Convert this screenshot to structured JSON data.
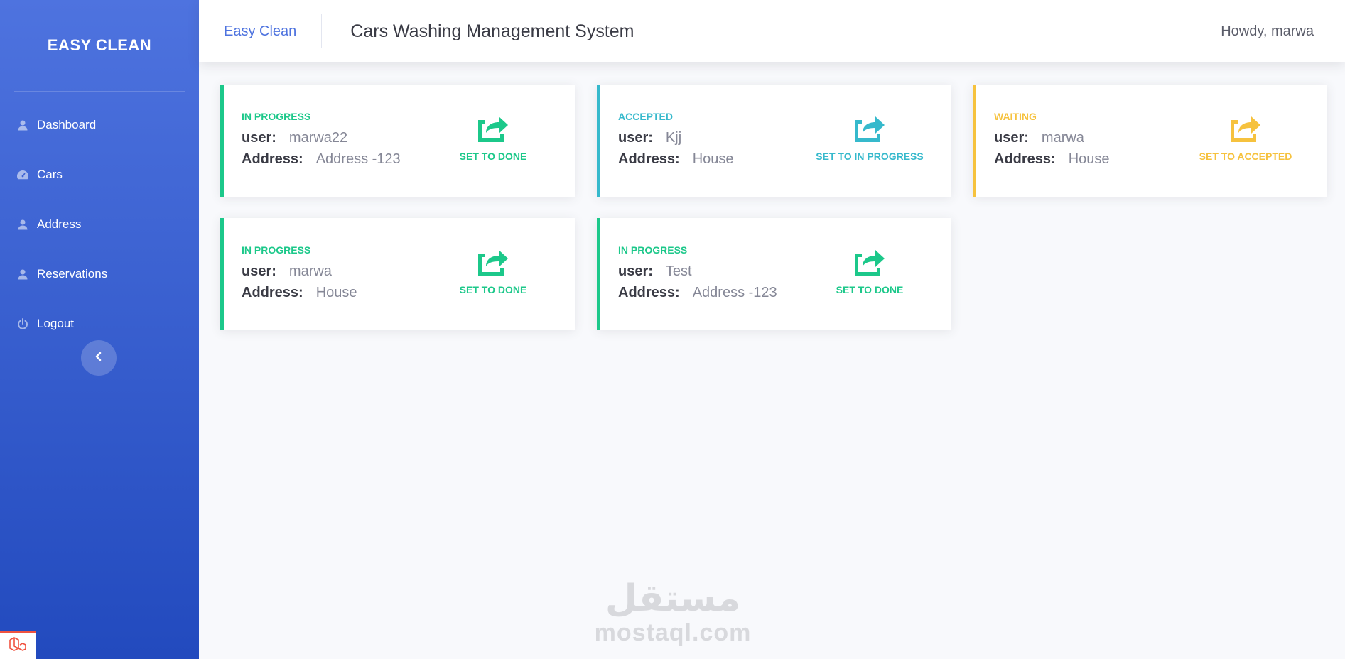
{
  "sidebar": {
    "brand": "EASY CLEAN",
    "items": [
      {
        "label": "Dashboard",
        "icon": "user-icon"
      },
      {
        "label": "Cars",
        "icon": "dashboard-gauge-icon"
      },
      {
        "label": "Address",
        "icon": "user-icon"
      },
      {
        "label": "Reservations",
        "icon": "user-icon"
      },
      {
        "label": "Logout",
        "icon": "power-icon"
      }
    ]
  },
  "topbar": {
    "brand_link": "Easy Clean",
    "title": "Cars Washing Management System",
    "greeting": "Howdy, marwa"
  },
  "cards": [
    {
      "status": "IN PROGRESS",
      "user_key": "user:",
      "user": "marwa22",
      "address_key": "Address:",
      "address": "Address -123",
      "action": "SET TO DONE",
      "color": "#1cc88a"
    },
    {
      "status": "ACCEPTED",
      "user_key": "user:",
      "user": "Kjj",
      "address_key": "Address:",
      "address": "House",
      "action": "SET TO IN PROGRESS",
      "color": "#36b9cc"
    },
    {
      "status": "WAITING",
      "user_key": "user:",
      "user": "marwa",
      "address_key": "Address:",
      "address": "House",
      "action": "SET TO ACCEPTED",
      "color": "#f6c23e"
    },
    {
      "status": "IN PROGRESS",
      "user_key": "user:",
      "user": "marwa",
      "address_key": "Address:",
      "address": "House",
      "action": "SET TO DONE",
      "color": "#1cc88a"
    },
    {
      "status": "IN PROGRESS",
      "user_key": "user:",
      "user": "Test",
      "address_key": "Address:",
      "address": "Address -123",
      "action": "SET TO DONE",
      "color": "#1cc88a"
    }
  ],
  "watermark": {
    "arabic": "مستقل",
    "latin": "mostaql.com"
  },
  "colors": {
    "primary": "#4e73df",
    "success": "#1cc88a",
    "info": "#36b9cc",
    "warning": "#f6c23e"
  }
}
